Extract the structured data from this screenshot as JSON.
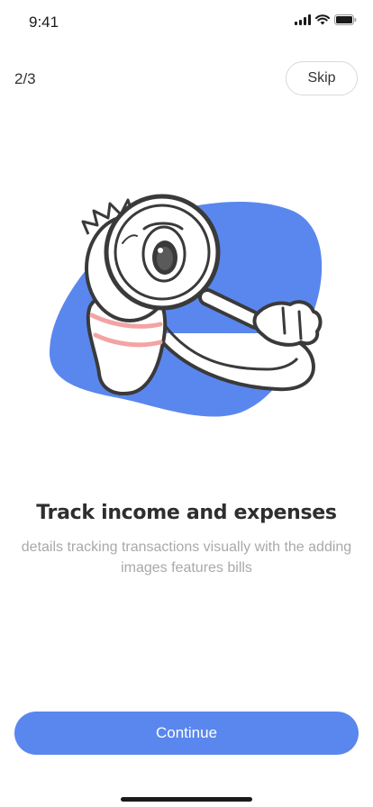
{
  "status_bar": {
    "time": "9:41",
    "icons": [
      "signal-icon",
      "wifi-icon",
      "battery-icon"
    ]
  },
  "onboarding": {
    "page_indicator": "2/3",
    "skip_label": "Skip",
    "illustration": "person-with-magnifying-glass",
    "title": "Track income and expenses",
    "subtitle": "details tracking transactions visually with the adding images features bills",
    "continue_label": "Continue"
  },
  "colors": {
    "accent": "#5a87ee",
    "blob": "#5a87ee",
    "stripe": "#f4a3a3",
    "title": "#2e2e2e",
    "subtitle": "#a9a9a9"
  }
}
